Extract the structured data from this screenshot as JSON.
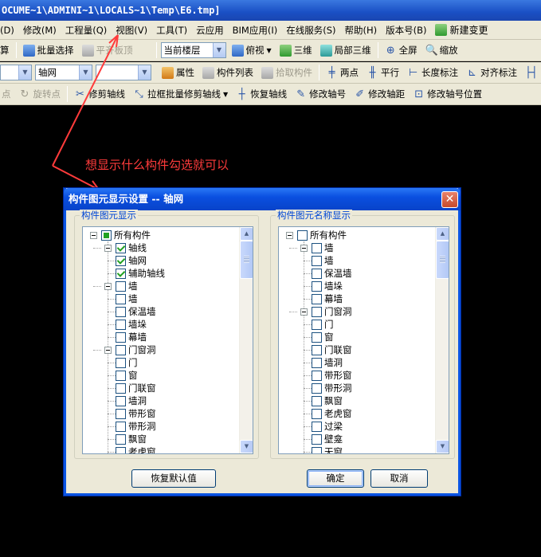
{
  "window": {
    "title": "OCUME~1\\ADMINI~1\\LOCALS~1\\Temp\\E6.tmp]"
  },
  "menubar": {
    "items": [
      "(D)",
      "修改(M)",
      "工程量(Q)",
      "视图(V)",
      "工具(T)",
      "云应用",
      "BIM应用(I)",
      "在线服务(S)",
      "帮助(H)",
      "版本号(B)"
    ],
    "new_change": "新建变更"
  },
  "toolbar1": {
    "cut_label": "算",
    "batch_select": "批量选择",
    "flat_top": "平齐板顶",
    "floor_select": "当前楼层",
    "top_view": "俯视",
    "three_d": "三维",
    "local_3d": "局部三维",
    "fullscreen": "全屏",
    "zoom": "缩放"
  },
  "toolbar2": {
    "combo1_value": "",
    "combo2_value": "轴网",
    "combo3_value": "",
    "properties": "属性",
    "component_list": "构件列表",
    "pick_component": "拾取构件",
    "two_points": "两点",
    "parallel": "平行",
    "length_mark": "长度标注",
    "align_mark": "对齐标注"
  },
  "toolbar3": {
    "point": "点",
    "rotate_point": "旋转点",
    "trim_axis": "修剪轴线",
    "box_trim_axis": "拉框批量修剪轴线",
    "restore_axis": "恢复轴线",
    "modify_axis_no": "修改轴号",
    "modify_axis_distance": "修改轴距",
    "modify_axis_position": "修改轴号位置"
  },
  "annotation": {
    "text": "想显示什么构件勾选就可以",
    "color": "#ff3b3b"
  },
  "dialog": {
    "title": "构件图元显示设置 -- 轴网",
    "left_group": {
      "legend": "构件图元显示",
      "nodes": [
        {
          "label": "所有构件",
          "state": "partial"
        },
        {
          "label": "轴线",
          "state": "checked"
        },
        {
          "label": "轴网",
          "state": "checked"
        },
        {
          "label": "辅助轴线",
          "state": "checked"
        },
        {
          "label": "墙",
          "state": "unchecked"
        },
        {
          "label": "墙",
          "state": "unchecked"
        },
        {
          "label": "保温墙",
          "state": "unchecked"
        },
        {
          "label": "墙垛",
          "state": "unchecked"
        },
        {
          "label": "幕墙",
          "state": "unchecked"
        },
        {
          "label": "门窗洞",
          "state": "unchecked"
        },
        {
          "label": "门",
          "state": "unchecked"
        },
        {
          "label": "窗",
          "state": "unchecked"
        },
        {
          "label": "门联窗",
          "state": "unchecked"
        },
        {
          "label": "墙洞",
          "state": "unchecked"
        },
        {
          "label": "带形窗",
          "state": "unchecked"
        },
        {
          "label": "带形洞",
          "state": "unchecked"
        },
        {
          "label": "飘窗",
          "state": "unchecked"
        },
        {
          "label": "老虎窗",
          "state": "unchecked"
        }
      ]
    },
    "right_group": {
      "legend": "构件图元名称显示",
      "nodes": [
        {
          "label": "所有构件",
          "state": "unchecked"
        },
        {
          "label": "墙",
          "state": "unchecked"
        },
        {
          "label": "墙",
          "state": "unchecked"
        },
        {
          "label": "保温墙",
          "state": "unchecked"
        },
        {
          "label": "墙垛",
          "state": "unchecked"
        },
        {
          "label": "幕墙",
          "state": "unchecked"
        },
        {
          "label": "门窗洞",
          "state": "unchecked"
        },
        {
          "label": "门",
          "state": "unchecked"
        },
        {
          "label": "窗",
          "state": "unchecked"
        },
        {
          "label": "门联窗",
          "state": "unchecked"
        },
        {
          "label": "墙洞",
          "state": "unchecked"
        },
        {
          "label": "带形窗",
          "state": "unchecked"
        },
        {
          "label": "带形洞",
          "state": "unchecked"
        },
        {
          "label": "飘窗",
          "state": "unchecked"
        },
        {
          "label": "老虎窗",
          "state": "unchecked"
        },
        {
          "label": "过梁",
          "state": "unchecked"
        },
        {
          "label": "壁龛",
          "state": "unchecked"
        },
        {
          "label": "天窗",
          "state": "unchecked"
        }
      ]
    },
    "restore_default": "恢复默认值",
    "ok": "确定",
    "cancel": "取消"
  }
}
